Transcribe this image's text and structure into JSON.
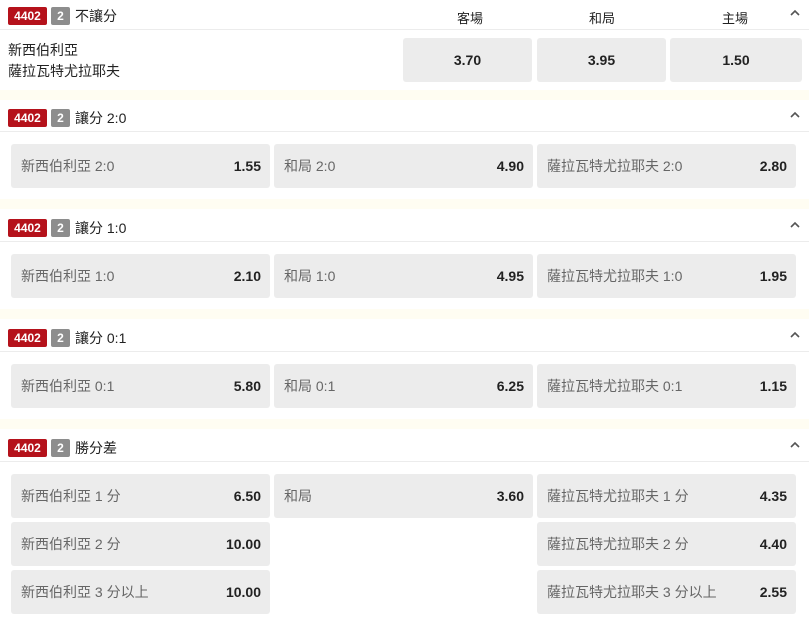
{
  "code": "4402",
  "num": "2",
  "market1": {
    "name": "不讓分",
    "col_away": "客場",
    "col_draw": "和局",
    "col_home": "主場",
    "team1": "新西伯利亞",
    "team2": "薩拉瓦特尤拉耶夫",
    "odds": [
      "3.70",
      "3.95",
      "1.50"
    ]
  },
  "market2": {
    "name": "讓分 2:0",
    "cells": [
      {
        "label": "新西伯利亞 2:0",
        "odd": "1.55"
      },
      {
        "label": "和局 2:0",
        "odd": "4.90"
      },
      {
        "label": "薩拉瓦特尤拉耶夫 2:0",
        "odd": "2.80"
      }
    ]
  },
  "market3": {
    "name": "讓分 1:0",
    "cells": [
      {
        "label": "新西伯利亞 1:0",
        "odd": "2.10"
      },
      {
        "label": "和局 1:0",
        "odd": "4.95"
      },
      {
        "label": "薩拉瓦特尤拉耶夫 1:0",
        "odd": "1.95"
      }
    ]
  },
  "market4": {
    "name": "讓分 0:1",
    "cells": [
      {
        "label": "新西伯利亞 0:1",
        "odd": "5.80"
      },
      {
        "label": "和局 0:1",
        "odd": "6.25"
      },
      {
        "label": "薩拉瓦特尤拉耶夫 0:1",
        "odd": "1.15"
      }
    ]
  },
  "market5": {
    "name": "勝分差",
    "cells": [
      {
        "label": "新西伯利亞 1 分",
        "odd": "6.50"
      },
      {
        "label": "和局",
        "odd": "3.60"
      },
      {
        "label": "薩拉瓦特尤拉耶夫 1 分",
        "odd": "4.35"
      },
      {
        "label": "新西伯利亞 2 分",
        "odd": "10.00"
      },
      {
        "label": "薩拉瓦特尤拉耶夫 2 分",
        "odd": "4.40"
      },
      {
        "label": "新西伯利亞 3 分以上",
        "odd": "10.00"
      },
      {
        "label": "薩拉瓦特尤拉耶夫 3 分以上",
        "odd": "2.55"
      }
    ]
  },
  "icons": {
    "collapse": "chevron-up-icon"
  }
}
